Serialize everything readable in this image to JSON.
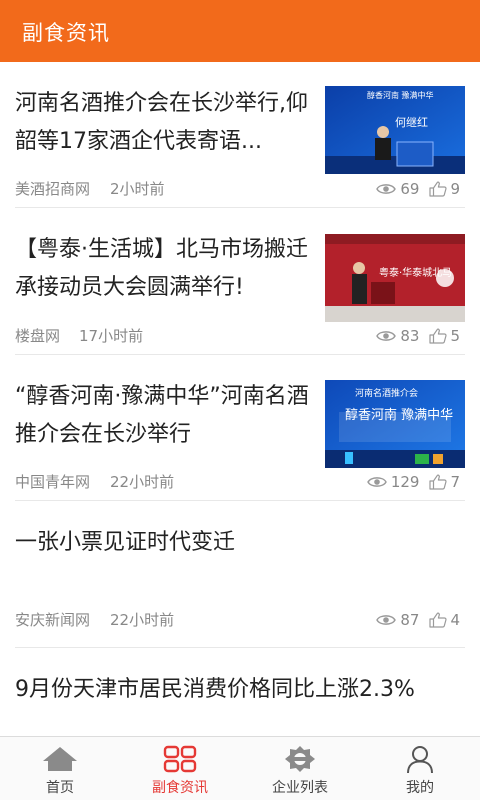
{
  "header": {
    "title": "副食资讯"
  },
  "colors": {
    "accent": "#f26a1b",
    "active_tab": "#e53935",
    "meta_text": "#888888"
  },
  "articles": [
    {
      "title": "河南名酒推介会在长沙举行,仰韶等17家酒企代表寄语...",
      "source": "美酒招商网",
      "time": "2小时前",
      "views": "69",
      "likes": "9",
      "thumb_banner": "醇香河南 豫满中华",
      "thumb_name": "何继红"
    },
    {
      "title": "【粤泰·生活城】北马市场搬迁承接动员大会圆满举行!",
      "source": "楼盘网",
      "time": "17小时前",
      "views": "83",
      "likes": "5",
      "thumb_banner": "粤泰·华泰城北马"
    },
    {
      "title": "“醇香河南·豫满中华”河南名酒推介会在长沙举行",
      "source": "中国青年网",
      "time": "22小时前",
      "views": "129",
      "likes": "7",
      "thumb_top": "河南名酒推介会",
      "thumb_banner": "醇香河南 豫满中华"
    },
    {
      "title": "一张小票见证时代变迁",
      "source": "安庆新闻网",
      "time": "22小时前",
      "views": "87",
      "likes": "4"
    },
    {
      "title": "9月份天津市居民消费价格同比上涨2.3%"
    }
  ],
  "tabs": [
    {
      "label": "首页",
      "icon": "home-icon"
    },
    {
      "label": "副食资讯",
      "icon": "grid-icon",
      "active": true
    },
    {
      "label": "企业列表",
      "icon": "enterprise-icon"
    },
    {
      "label": "我的",
      "icon": "person-icon"
    }
  ]
}
